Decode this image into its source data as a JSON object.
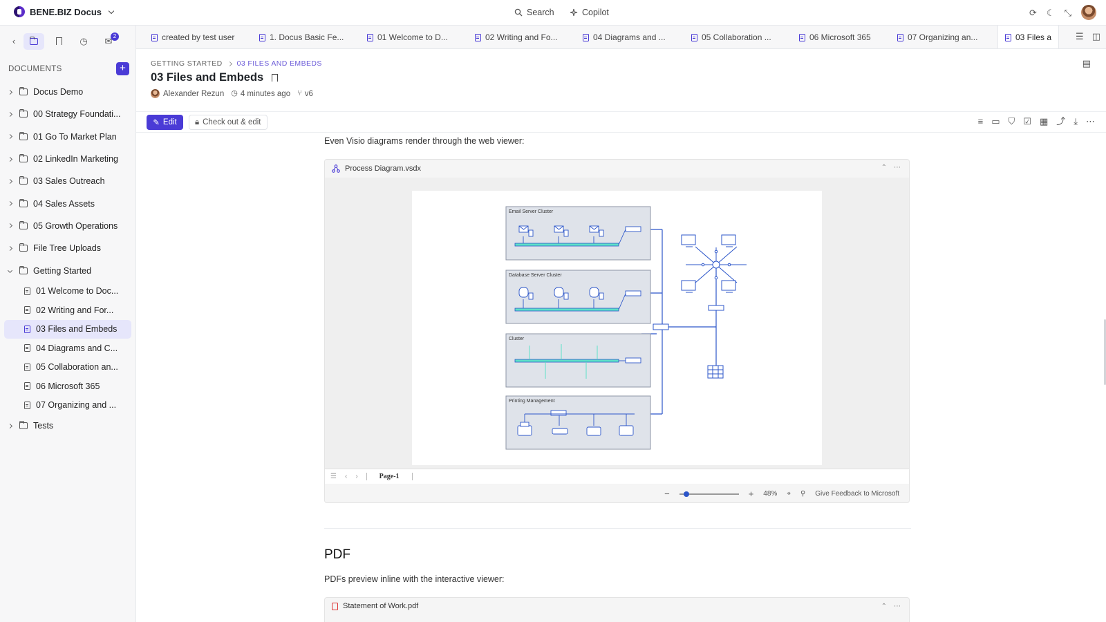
{
  "topbar": {
    "brand": "BENE.BIZ Docus",
    "search_label": "Search",
    "copilot_label": "Copilot"
  },
  "sidebar": {
    "notification_count": "2",
    "documents_heading": "DOCUMENTS",
    "folders": [
      {
        "label": "Docus Demo"
      },
      {
        "label": "00 Strategy Foundati..."
      },
      {
        "label": "01 Go To Market Plan"
      },
      {
        "label": "02 LinkedIn Marketing"
      },
      {
        "label": "03 Sales Outreach"
      },
      {
        "label": "04 Sales Assets"
      },
      {
        "label": "05 Growth Operations"
      },
      {
        "label": "File Tree Uploads"
      },
      {
        "label": "Getting Started"
      }
    ],
    "getting_started_docs": [
      {
        "label": "01 Welcome to Doc..."
      },
      {
        "label": "02 Writing and For..."
      },
      {
        "label": "03 Files and Embeds"
      },
      {
        "label": "04 Diagrams and C..."
      },
      {
        "label": "05 Collaboration an..."
      },
      {
        "label": "06 Microsoft 365"
      },
      {
        "label": "07 Organizing and ..."
      }
    ],
    "tests_folder": "Tests"
  },
  "tabs": [
    {
      "label": "created by test user"
    },
    {
      "label": "1. Docus Basic Fe..."
    },
    {
      "label": "01 Welcome to D..."
    },
    {
      "label": "02 Writing and Fo..."
    },
    {
      "label": "04 Diagrams and ..."
    },
    {
      "label": "05 Collaboration ..."
    },
    {
      "label": "06 Microsoft 365"
    },
    {
      "label": "07 Organizing an..."
    },
    {
      "label": "03 Files a"
    }
  ],
  "document": {
    "breadcrumb_root": "GETTING STARTED",
    "breadcrumb_current": "03 FILES AND EMBEDS",
    "title": "03 Files and Embeds",
    "author": "Alexander Rezun",
    "updated": "4 minutes ago",
    "version": "v6"
  },
  "toolbar": {
    "edit_label": "Edit",
    "checkout_label": "Check out & edit"
  },
  "content": {
    "visio_intro": "Even Visio diagrams render through the web viewer:",
    "visio_file": "Process Diagram.vsdx",
    "page_tab": "Page-1",
    "zoom": "48%",
    "feedback_link": "Give Feedback to Microsoft",
    "pdf_heading": "PDF",
    "pdf_intro": "PDFs preview inline with the interactive viewer:",
    "pdf_file": "Statement of Work.pdf"
  },
  "diagram": {
    "groups": [
      {
        "label": "Email Server Cluster"
      },
      {
        "label": "Database Server Cluster"
      },
      {
        "label": "Cluster"
      },
      {
        "label": "Printing Management"
      }
    ]
  },
  "colors": {
    "accent": "#4a3bd6",
    "diagram_line": "#2b55c9",
    "diagram_bus": "#5ee0c8",
    "group_fill": "#dfe3ea"
  }
}
